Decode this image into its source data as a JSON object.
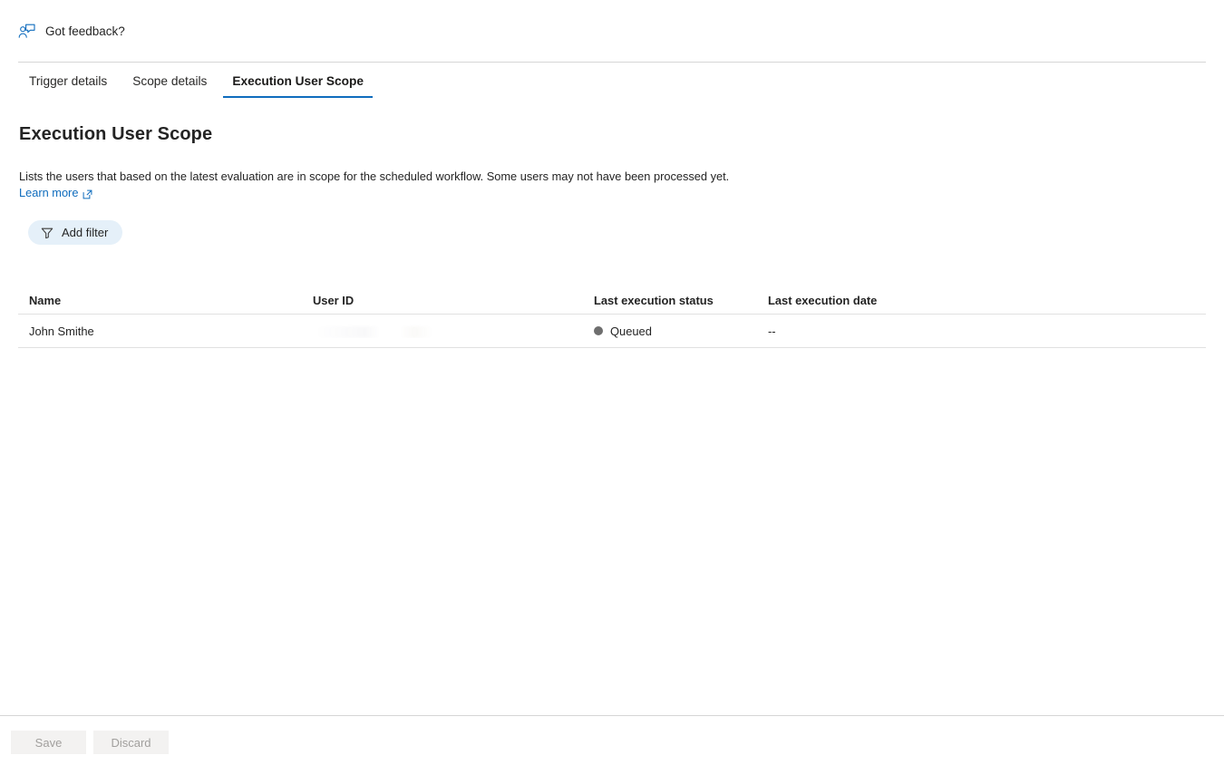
{
  "feedback": {
    "icon": "person-feedback-icon",
    "label": "Got feedback?"
  },
  "tabs": [
    {
      "label": "Trigger details",
      "active": false
    },
    {
      "label": "Scope details",
      "active": false
    },
    {
      "label": "Execution User Scope",
      "active": true
    }
  ],
  "content": {
    "title": "Execution User Scope",
    "description": "Lists the users that based on the latest evaluation are in scope for the scheduled workflow. Some users may not have been processed yet.",
    "learn_more_label": "Learn more",
    "learn_more_icon": "external-link-icon"
  },
  "toolbar": {
    "add_filter_label": "Add filter",
    "filter_icon": "filter-funnel-icon"
  },
  "table": {
    "columns": [
      "Name",
      "User ID",
      "Last execution status",
      "Last execution date"
    ],
    "rows": [
      {
        "name": "John Smithe",
        "user_id": "",
        "last_execution_status": "Queued",
        "last_execution_date": "--"
      }
    ]
  },
  "footer": {
    "save_label": "Save",
    "discard_label": "Discard"
  },
  "colors": {
    "accent": "#0f6cbd",
    "link": "#0f6cbd",
    "status_queued_dot": "#6e6e6e",
    "filter_pill_bg": "#e5f0f9",
    "divider": "#d6d6d6",
    "disabled_button_bg": "#f3f2f1",
    "disabled_button_text": "#a19f9d"
  }
}
